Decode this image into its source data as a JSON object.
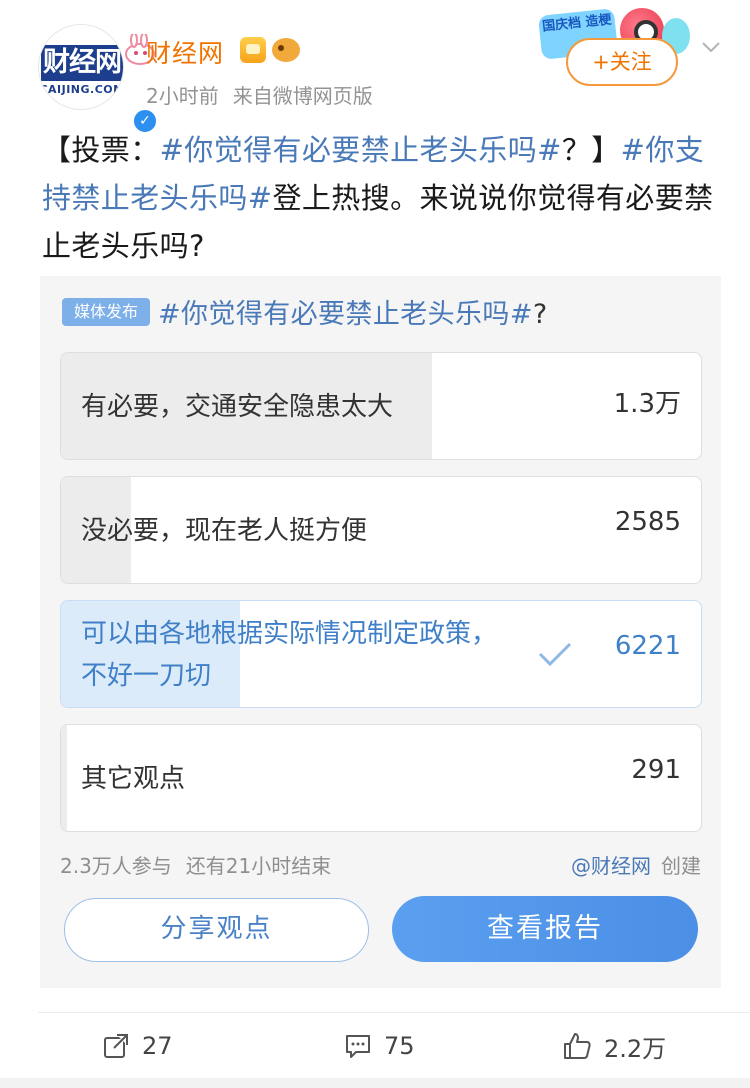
{
  "post": {
    "author": "财经网",
    "avatar_text": "财经网",
    "avatar_subtext": "CAIJING.COM",
    "time": "2小时前",
    "source": "来自微博网页版",
    "follow_label": "+关注",
    "promo_text": "国庆档 造梗",
    "text_prefix": "【投票：",
    "text_topic1": "#你觉得有必要禁止老头乐吗#",
    "text_mid": "？】",
    "text_topic2": "#你支持禁止老头乐吗#",
    "text_suffix": "登上热搜。来说说你觉得有必要禁止老头乐吗?"
  },
  "poll": {
    "tag": "媒体发布",
    "title_topic": "#你觉得有必要禁止老头乐吗#",
    "title_suffix": "?",
    "options": [
      {
        "label": "有必要，交通安全隐患太大",
        "count": "1.3万",
        "share": 0.58,
        "selected": false
      },
      {
        "label": "没必要，现在老人挺方便",
        "count": "2585",
        "share": 0.11,
        "selected": false
      },
      {
        "label": "可以由各地根据实际情况制定政策，不好一刀切",
        "count": "6221",
        "share": 0.28,
        "selected": true
      },
      {
        "label": "其它观点",
        "count": "291",
        "share": 0.01,
        "selected": false
      }
    ],
    "participants": "2.3万人参与",
    "time_left": "还有21小时结束",
    "creator": "@财经网",
    "created_label": "创建",
    "share_button": "分享观点",
    "report_button": "查看报告"
  },
  "actions": {
    "repost_count": "27",
    "comment_count": "75",
    "like_count": "2.2万"
  },
  "colors": {
    "accent_orange": "#f07300",
    "link_blue": "#4a79b8",
    "primary_blue": "#4b8fe6"
  }
}
